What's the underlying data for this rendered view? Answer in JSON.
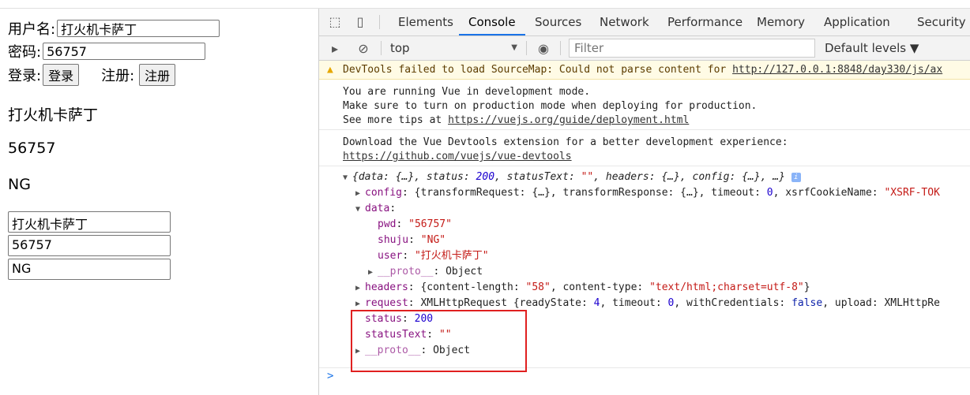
{
  "left": {
    "username_label": "用户名:",
    "username_value": "打火机卡萨丁",
    "password_label": "密码:",
    "password_value": "56757",
    "login_label": "登录:",
    "login_button": "登录",
    "register_label": "注册:",
    "register_button": "注册",
    "out_user": "打火机卡萨丁",
    "out_pwd": "56757",
    "out_shuju": "NG",
    "box_user": "打火机卡萨丁",
    "box_pwd": "56757",
    "box_shuju": "NG"
  },
  "devtools": {
    "tabs": [
      "Elements",
      "Console",
      "Sources",
      "Network",
      "Performance",
      "Memory",
      "Application",
      "Security"
    ],
    "active_tab": "Console",
    "context": "top",
    "filter_placeholder": "Filter",
    "levels": "Default levels ▼",
    "warning_text": "DevTools failed to load SourceMap: Could not parse content for ",
    "warning_link": "http://127.0.0.1:8848/day330/js/ax",
    "vue_msg_1": "You are running Vue in development mode.",
    "vue_msg_2": "Make sure to turn on production mode when deploying for production.",
    "vue_msg_3_prefix": "See more tips at ",
    "vue_msg_3_link": "https://vuejs.org/guide/deployment.html",
    "devtools_msg_1": "Download the Vue Devtools extension for a better development experience:",
    "devtools_msg_2_link": "https://github.com/vuejs/vue-devtools",
    "obj_summary_1": "{data: {…}, status: ",
    "obj_summary_status": "200",
    "obj_summary_2": ", statusText: ",
    "obj_summary_statustext": "\"\"",
    "obj_summary_3": ", headers: {…}, config: {…}, …}",
    "config_key": "config",
    "config_value_1": ": {transformRequest: {…}, transformResponse: {…}, timeout: ",
    "config_timeout": "0",
    "config_value_2": ", xsrfCookieName: ",
    "config_xsrf": "\"XSRF-TOK",
    "data_key": "data",
    "pwd_key": "pwd",
    "pwd_value": "\"56757\"",
    "shuju_key": "shuju",
    "shuju_value": "\"NG\"",
    "user_key": "user",
    "user_value": "\"打火机卡萨丁\"",
    "proto_key": "__proto__",
    "proto_value": ": Object",
    "headers_key": "headers",
    "headers_value_1": ": {content-length: ",
    "headers_len": "\"58\"",
    "headers_value_2": ", content-type: ",
    "headers_type": "\"text/html;charset=utf-8\"",
    "headers_value_3": "}",
    "request_key": "request",
    "request_value_1": ": XMLHttpRequest {readyState: ",
    "request_ready": "4",
    "request_value_2": ", timeout: ",
    "request_timeout": "0",
    "request_value_3": ", withCredentials: ",
    "request_cred": "false",
    "request_value_4": ", upload: XMLHttpRe",
    "status_key": "status",
    "status_value": "200",
    "statustext_key": "statusText",
    "statustext_value": "\"\"",
    "proto2_key": "__proto__",
    "proto2_value": ": Object",
    "prompt": ">"
  }
}
